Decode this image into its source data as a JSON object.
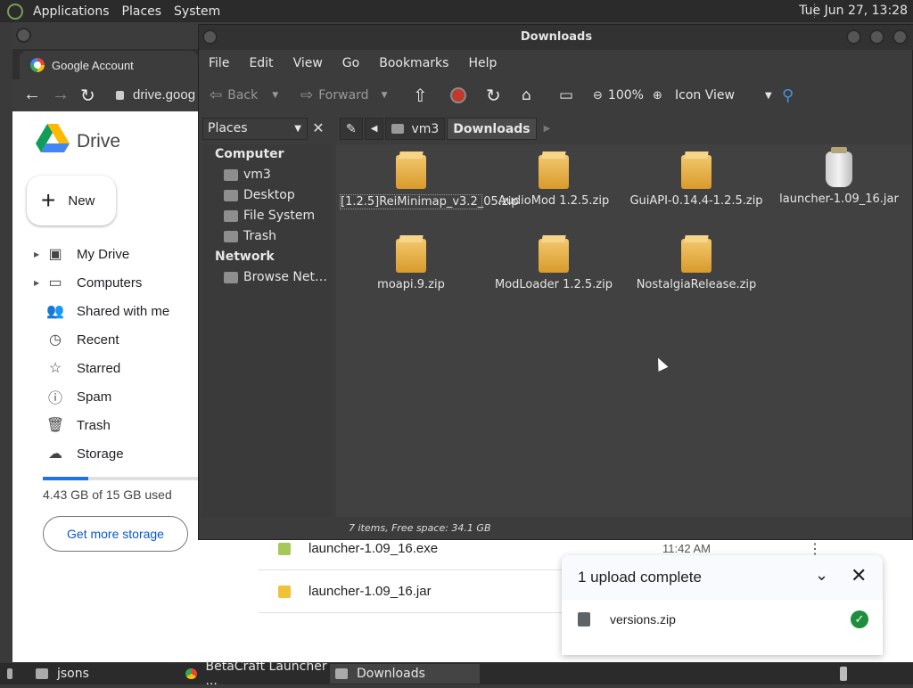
{
  "top_panel": {
    "menus": [
      "Applications",
      "Places",
      "System"
    ],
    "clock": "Tue Jun 27, 13:28"
  },
  "chrome": {
    "tab_title": "Google Account",
    "address": "drive.goog",
    "drive": {
      "title": "Drive",
      "new_label": "New",
      "nav": [
        {
          "label": "My Drive",
          "icon": "my-drive-icon",
          "caret": true
        },
        {
          "label": "Computers",
          "icon": "computers-icon",
          "caret": true
        },
        {
          "label": "Shared with me",
          "icon": "shared-icon",
          "caret": false
        },
        {
          "label": "Recent",
          "icon": "clock-icon",
          "caret": false
        },
        {
          "label": "Starred",
          "icon": "star-icon",
          "caret": false
        },
        {
          "label": "Spam",
          "icon": "spam-icon",
          "caret": false
        },
        {
          "label": "Trash",
          "icon": "trash-icon",
          "caret": false
        },
        {
          "label": "Storage",
          "icon": "cloud-icon",
          "caret": false
        }
      ],
      "storage_text": "4.43 GB of 15 GB used",
      "storage_fraction": 0.295,
      "more_storage": "Get more storage",
      "files": [
        {
          "name": "launcher-1.09_16.exe",
          "time": "11:42 AM"
        },
        {
          "name": "launcher-1.09_16.jar",
          "time": ""
        }
      ],
      "upload": {
        "heading": "1 upload complete",
        "file": "versions.zip"
      }
    }
  },
  "file_manager": {
    "title": "Downloads",
    "menu": [
      "File",
      "Edit",
      "View",
      "Go",
      "Bookmarks",
      "Help"
    ],
    "toolbar": {
      "back": "Back",
      "forward": "Forward",
      "zoom": "100%",
      "view_mode": "Icon View"
    },
    "places_label": "Places",
    "breadcrumbs": [
      "vm3",
      "Downloads"
    ],
    "sidebar": {
      "computer_heading": "Computer",
      "computer_items": [
        "vm3",
        "Desktop",
        "File System",
        "Trash"
      ],
      "network_heading": "Network",
      "network_items": [
        "Browse Net…"
      ]
    },
    "files": [
      {
        "name": "[1.2.5]ReiMinimap_v3.2_05.zip",
        "type": "zip"
      },
      {
        "name": "AudioMod 1.2.5.zip",
        "type": "zip"
      },
      {
        "name": "GuiAPI-0.14.4-1.2.5.zip",
        "type": "zip"
      },
      {
        "name": "launcher-1.09_16.jar",
        "type": "jar"
      },
      {
        "name": "moapi.9.zip",
        "type": "zip"
      },
      {
        "name": "ModLoader 1.2.5.zip",
        "type": "zip"
      },
      {
        "name": "NostalgiaRelease.zip",
        "type": "zip"
      }
    ],
    "status": "7 items, Free space: 34.1 GB"
  },
  "taskbar": [
    {
      "label": "jsons",
      "active": false
    },
    {
      "label": "BetaCraft Launcher ...",
      "active": false
    },
    {
      "label": "Downloads",
      "active": true
    }
  ]
}
